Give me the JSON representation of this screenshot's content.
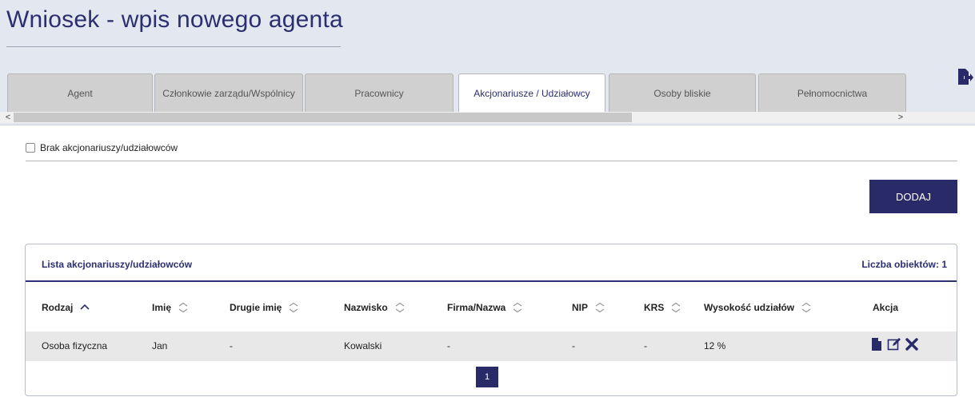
{
  "page": {
    "title": "Wniosek - wpis nowego agenta"
  },
  "tabs": [
    {
      "label": "Agent"
    },
    {
      "label": "Członkowie zarządu/Wspólnicy"
    },
    {
      "label": "Pracownicy"
    },
    {
      "label": "Akcjonariusze / Udziałowcy",
      "active": true
    },
    {
      "label": "Osoby bliskie"
    },
    {
      "label": "Pełnomocnictwa"
    }
  ],
  "scrollbar": {
    "left_arrow": "<",
    "right_arrow": ">"
  },
  "no_shareholders": {
    "label": "Brak akcjonariuszy/udziałowców",
    "checked": false
  },
  "add_button": {
    "label": "DODAJ"
  },
  "list": {
    "title": "Lista akcjonariuszy/udziałowców",
    "count": "Liczba obiektów: 1",
    "columns": [
      "Rodzaj",
      "Imię",
      "Drugie imię",
      "Nazwisko",
      "Firma/Nazwa",
      "NIP",
      "KRS",
      "Wysokość udziałów",
      "Akcja"
    ],
    "rows": [
      {
        "rodzaj": "Osoba fizyczna",
        "imie": "Jan",
        "drugie_imie": "-",
        "nazwisko": "Kowalski",
        "firma": "-",
        "nip": "-",
        "krs": "-",
        "udzialy": "12 %"
      }
    ],
    "page": "1"
  },
  "colors": {
    "primary": "#292a68",
    "header_bg": "#e3e8f0",
    "row_bg": "#e8e8e8"
  },
  "icons": {
    "logout": "logout-icon",
    "view": "document-icon",
    "edit": "edit-icon",
    "delete": "delete-icon",
    "sort": "sort-icon"
  }
}
